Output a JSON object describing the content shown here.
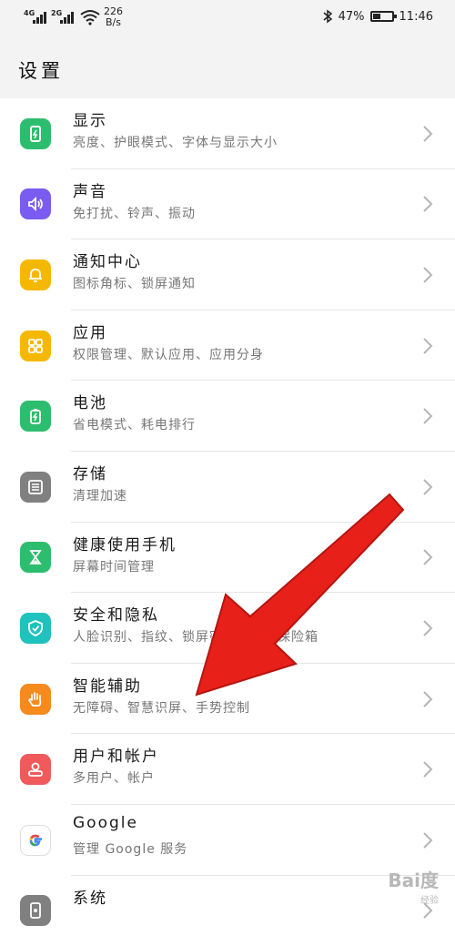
{
  "status_bar": {
    "network_1": "4G",
    "network_2": "2G",
    "speed_value": "226",
    "speed_unit": "B/s",
    "battery": "47%",
    "battery_level": 0.47,
    "time": "11:46"
  },
  "header": {
    "title": "设置"
  },
  "settings": [
    {
      "title": "显示",
      "subtitle": "亮度、护眼模式、字体与显示大小",
      "icon": "display-icon",
      "color": "#2dbd6e"
    },
    {
      "title": "声音",
      "subtitle": "免打扰、铃声、振动",
      "icon": "speaker-icon",
      "color": "#7a5cf0"
    },
    {
      "title": "通知中心",
      "subtitle": "图标角标、锁屏通知",
      "icon": "bell-icon",
      "color": "#f5b800"
    },
    {
      "title": "应用",
      "subtitle": "权限管理、默认应用、应用分身",
      "icon": "apps-grid-icon",
      "color": "#f5b800"
    },
    {
      "title": "电池",
      "subtitle": "省电模式、耗电排行",
      "icon": "battery-icon",
      "color": "#2dbd6e"
    },
    {
      "title": "存储",
      "subtitle": "清理加速",
      "icon": "storage-icon",
      "color": "#808080"
    },
    {
      "title": "健康使用手机",
      "subtitle": "屏幕时间管理",
      "icon": "hourglass-icon",
      "color": "#2dbd6e"
    },
    {
      "title": "安全和隐私",
      "subtitle": "人脸识别、指纹、锁屏密码、密码保险箱",
      "icon": "shield-icon",
      "color": "#1fc2bd"
    },
    {
      "title": "智能辅助",
      "subtitle": "无障碍、智慧识屏、手势控制",
      "icon": "hand-icon",
      "color": "#f78a1d"
    },
    {
      "title": "用户和帐户",
      "subtitle": "多用户、帐户",
      "icon": "user-icon",
      "color": "#f05a5a"
    },
    {
      "title": "Google",
      "subtitle": "管理 Google 服务",
      "icon": "google-icon",
      "color": "#ffffff"
    },
    {
      "title": "系统",
      "subtitle": "",
      "icon": "system-icon",
      "color": "#808080"
    }
  ],
  "watermark": {
    "brand": "Bai度",
    "sub": "经验"
  }
}
